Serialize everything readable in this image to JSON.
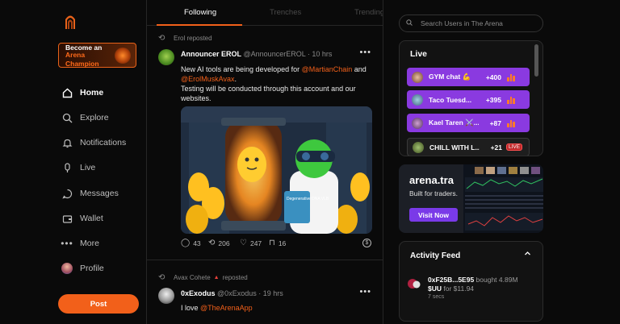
{
  "sidebar": {
    "promo": {
      "line1": "Become an",
      "line2": "Arena",
      "line3": "Champion"
    },
    "items": [
      {
        "label": "Home",
        "icon": "home-icon"
      },
      {
        "label": "Explore",
        "icon": "explore-icon"
      },
      {
        "label": "Notifications",
        "icon": "bell-icon"
      },
      {
        "label": "Live",
        "icon": "live-icon"
      },
      {
        "label": "Messages",
        "icon": "message-icon"
      },
      {
        "label": "Wallet",
        "icon": "wallet-icon"
      },
      {
        "label": "More",
        "icon": "more-icon"
      },
      {
        "label": "Profile",
        "icon": "avatar"
      }
    ],
    "post_label": "Post"
  },
  "tabs": [
    "Following",
    "Trenches",
    "Trending"
  ],
  "posts": [
    {
      "reposted_by": "Erol reposted",
      "name": "Announcer EROL",
      "handle": "@AnnouncerEROL",
      "time": "10 hrs",
      "text_a": "New AI tools are being developed for ",
      "mention_a": "@MartianChain",
      "text_b": " and",
      "mention_b": "@ErolMuskAvax",
      "text_c": ".",
      "text_d": "Testing will be conducted through this account and our websites.",
      "image_label": "Degenerative DNA VLB",
      "comments": "43",
      "reposts": "206",
      "likes": "247",
      "bookmarks": "16"
    },
    {
      "reposted_by": "Avax Cohete",
      "reposted_suffix": "reposted",
      "name": "0xExodus",
      "handle": "@0xExodus",
      "time": "19 hrs",
      "text_a": "I love ",
      "mention_a": "@TheArenaApp"
    }
  ],
  "search": {
    "placeholder": "Search Users in The Arena"
  },
  "live": {
    "title": "Live",
    "items": [
      {
        "name": "GYM chat 💪",
        "count": "+400"
      },
      {
        "name": "Taco Tuesd...",
        "count": "+395"
      },
      {
        "name": "Kael Taren ⚔️...",
        "count": "+87"
      },
      {
        "name": "CHILL WITH L...",
        "count": "+21",
        "tag": "LIVE"
      }
    ]
  },
  "ad": {
    "title": "arena.tra",
    "subtitle": "Built for traders.",
    "button": "Visit Now"
  },
  "activity": {
    "title": "Activity Feed",
    "user": "0xF25B...5E95",
    "action": " bought 4.89M",
    "token": "$UU",
    "price": " for $11.94",
    "time": "7 secs"
  },
  "colors": {
    "accent": "#f2601a",
    "live_purple": "#8a3ae0"
  }
}
